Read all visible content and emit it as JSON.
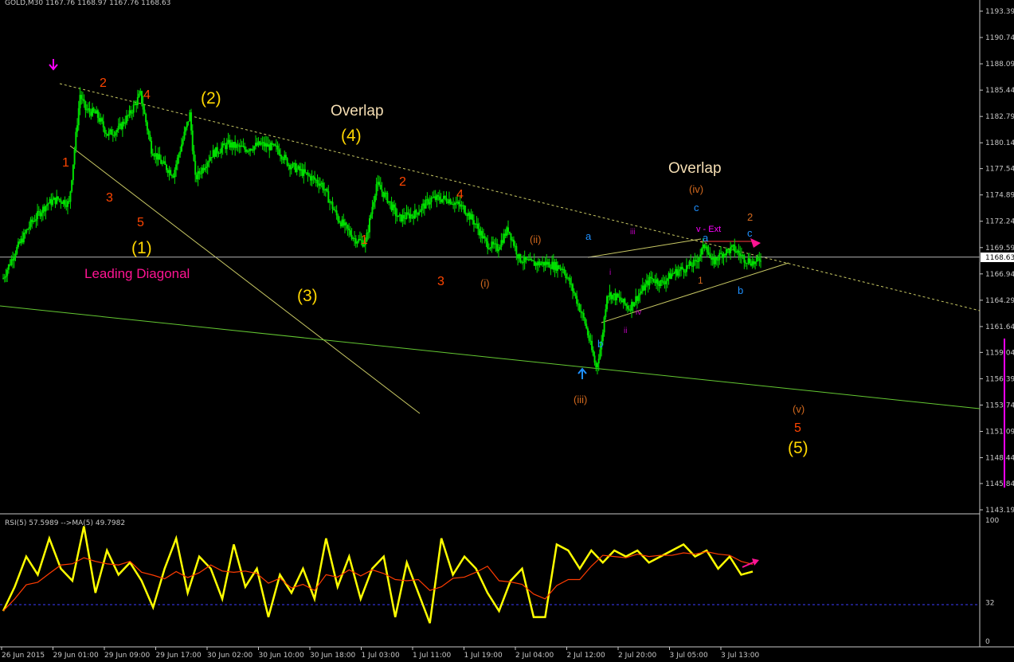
{
  "header": {
    "main_title": "GOLD,M30 1167.76 1168.97 1167.76 1168.63",
    "rsi_title": "RSI(5) 57.5989 -->MA(5) 49.7982"
  },
  "current_price_label": "1168.63",
  "colors": {
    "background": "#000000",
    "candle": "#00e000",
    "rsi": "#ffff00",
    "rsi_ma": "#ff3c00",
    "trendline": "#c8c864",
    "price_line": "#b4b4b4",
    "highlight": "#ff00ff",
    "arrow_pink": "#ff1493",
    "arrow_blue": "#1e90ff",
    "level_line": "#3c3cff"
  },
  "chart_data": [
    {
      "type": "candlestick",
      "symbol": "GOLD",
      "timeframe": "M30",
      "ylim": [
        1143.19,
        1195.0
      ],
      "y_ticks": [
        1193.39,
        1190.74,
        1188.09,
        1185.44,
        1182.79,
        1180.14,
        1177.54,
        1174.89,
        1172.24,
        1169.59,
        1166.94,
        1164.29,
        1161.64,
        1159.04,
        1156.39,
        1153.74,
        1151.09,
        1148.44,
        1145.84,
        1143.19
      ],
      "x_ticks": [
        "26 Jun 2015",
        "29 Jun 01:00",
        "29 Jun 09:00",
        "29 Jun 17:00",
        "30 Jun 02:00",
        "30 Jun 10:00",
        "30 Jun 18:00",
        "1 Jul 03:00",
        "1 Jul 11:00",
        "1 Jul 19:00",
        "2 Jul 04:00",
        "2 Jul 12:00",
        "2 Jul 20:00",
        "3 Jul 05:00",
        "3 Jul 13:00"
      ],
      "current_price": 1168.63,
      "close_path": [
        [
          0,
          1166.5
        ],
        [
          2,
          1169
        ],
        [
          5,
          1172
        ],
        [
          8,
          1174
        ],
        [
          10,
          1174.5
        ],
        [
          12,
          1174
        ],
        [
          14,
          1185
        ],
        [
          15,
          1183.5
        ],
        [
          17,
          1183
        ],
        [
          19,
          1181
        ],
        [
          21,
          1181.5
        ],
        [
          23,
          1183
        ],
        [
          25,
          1185
        ],
        [
          27,
          1179.5
        ],
        [
          29,
          1178
        ],
        [
          31,
          1177
        ],
        [
          34,
          1183
        ],
        [
          35,
          1176.5
        ],
        [
          38,
          1179
        ],
        [
          41,
          1180
        ],
        [
          44,
          1179.5
        ],
        [
          47,
          1180
        ],
        [
          50,
          1179.5
        ],
        [
          52,
          1178
        ],
        [
          55,
          1177
        ],
        [
          58,
          1176
        ],
        [
          61,
          1172.5
        ],
        [
          64,
          1170.5
        ],
        [
          66,
          1170
        ],
        [
          68,
          1176
        ],
        [
          70,
          1174.5
        ],
        [
          72,
          1172.5
        ],
        [
          75,
          1173
        ],
        [
          78,
          1174.5
        ],
        [
          81,
          1174.5
        ],
        [
          84,
          1173.5
        ],
        [
          86,
          1172
        ],
        [
          88,
          1170
        ],
        [
          90,
          1169.5
        ],
        [
          92,
          1171.5
        ],
        [
          94,
          1168.5
        ],
        [
          96,
          1168
        ],
        [
          99,
          1168
        ],
        [
          102,
          1167.5
        ],
        [
          104,
          1165
        ],
        [
          106,
          1162
        ],
        [
          108,
          1157.5
        ],
        [
          109,
          1160
        ],
        [
          110,
          1165
        ],
        [
          112,
          1164.5
        ],
        [
          114,
          1163.5
        ],
        [
          116,
          1165
        ],
        [
          118,
          1166.5
        ],
        [
          120,
          1166
        ],
        [
          122,
          1167
        ],
        [
          124,
          1167.5
        ],
        [
          126,
          1168
        ],
        [
          128,
          1170
        ],
        [
          129,
          1168
        ],
        [
          131,
          1169
        ],
        [
          133,
          1169.5
        ],
        [
          135,
          1168.5
        ],
        [
          137,
          1168
        ],
        [
          138,
          1168.6
        ]
      ]
    },
    {
      "type": "line",
      "indicator": "RSI",
      "ylim": [
        0,
        100
      ],
      "y_ticks": [
        100,
        32,
        0
      ],
      "level": 32,
      "series": [
        {
          "name": "RSI(5)",
          "value": 57.5989,
          "values": [
            25,
            45,
            70,
            55,
            85,
            60,
            50,
            95,
            40,
            75,
            55,
            65,
            50,
            28,
            60,
            85,
            40,
            70,
            60,
            35,
            80,
            45,
            60,
            20,
            55,
            40,
            60,
            35,
            85,
            45,
            70,
            35,
            60,
            70,
            20,
            65,
            40,
            15,
            85,
            55,
            70,
            60,
            40,
            25,
            50,
            60,
            20,
            20,
            80,
            75,
            60,
            75,
            65,
            75,
            70,
            75,
            65,
            70,
            75,
            80,
            70,
            75,
            60,
            70,
            55,
            57.6
          ]
        },
        {
          "name": "MA(5)",
          "value": 49.7982
        }
      ]
    }
  ],
  "annotations": {
    "overlap_top": "Overlap",
    "overlap_right": "Overlap",
    "leading_diagonal": "Leading Diagonal",
    "wave_1_big": "(1)",
    "wave_2_big": "(2)",
    "wave_3_big": "(3)",
    "wave_4_big": "(4)",
    "wave_5_big": "(5)",
    "sub_1a": "1",
    "sub_2a": "2",
    "sub_3a": "3",
    "sub_4a": "4",
    "sub_5a": "5",
    "sub_2b": "2",
    "sub_4b": "4",
    "sub_1b": "1",
    "sub_3b": "3",
    "sub_5b": "5",
    "w_i": "(i)",
    "w_ii": "(ii)",
    "w_iii": "(iii)",
    "w_iv": "(iv)",
    "w_v": "(v)",
    "a1": "a",
    "b1": "b",
    "c1": "c",
    "a2": "a",
    "b2": "b",
    "c2": "c",
    "small_i": "i",
    "small_ii": "ii",
    "small_iii": "iii",
    "small_iv": "iv",
    "v_ext": "v - Ext",
    "small_1": "1",
    "small_2": "2"
  }
}
